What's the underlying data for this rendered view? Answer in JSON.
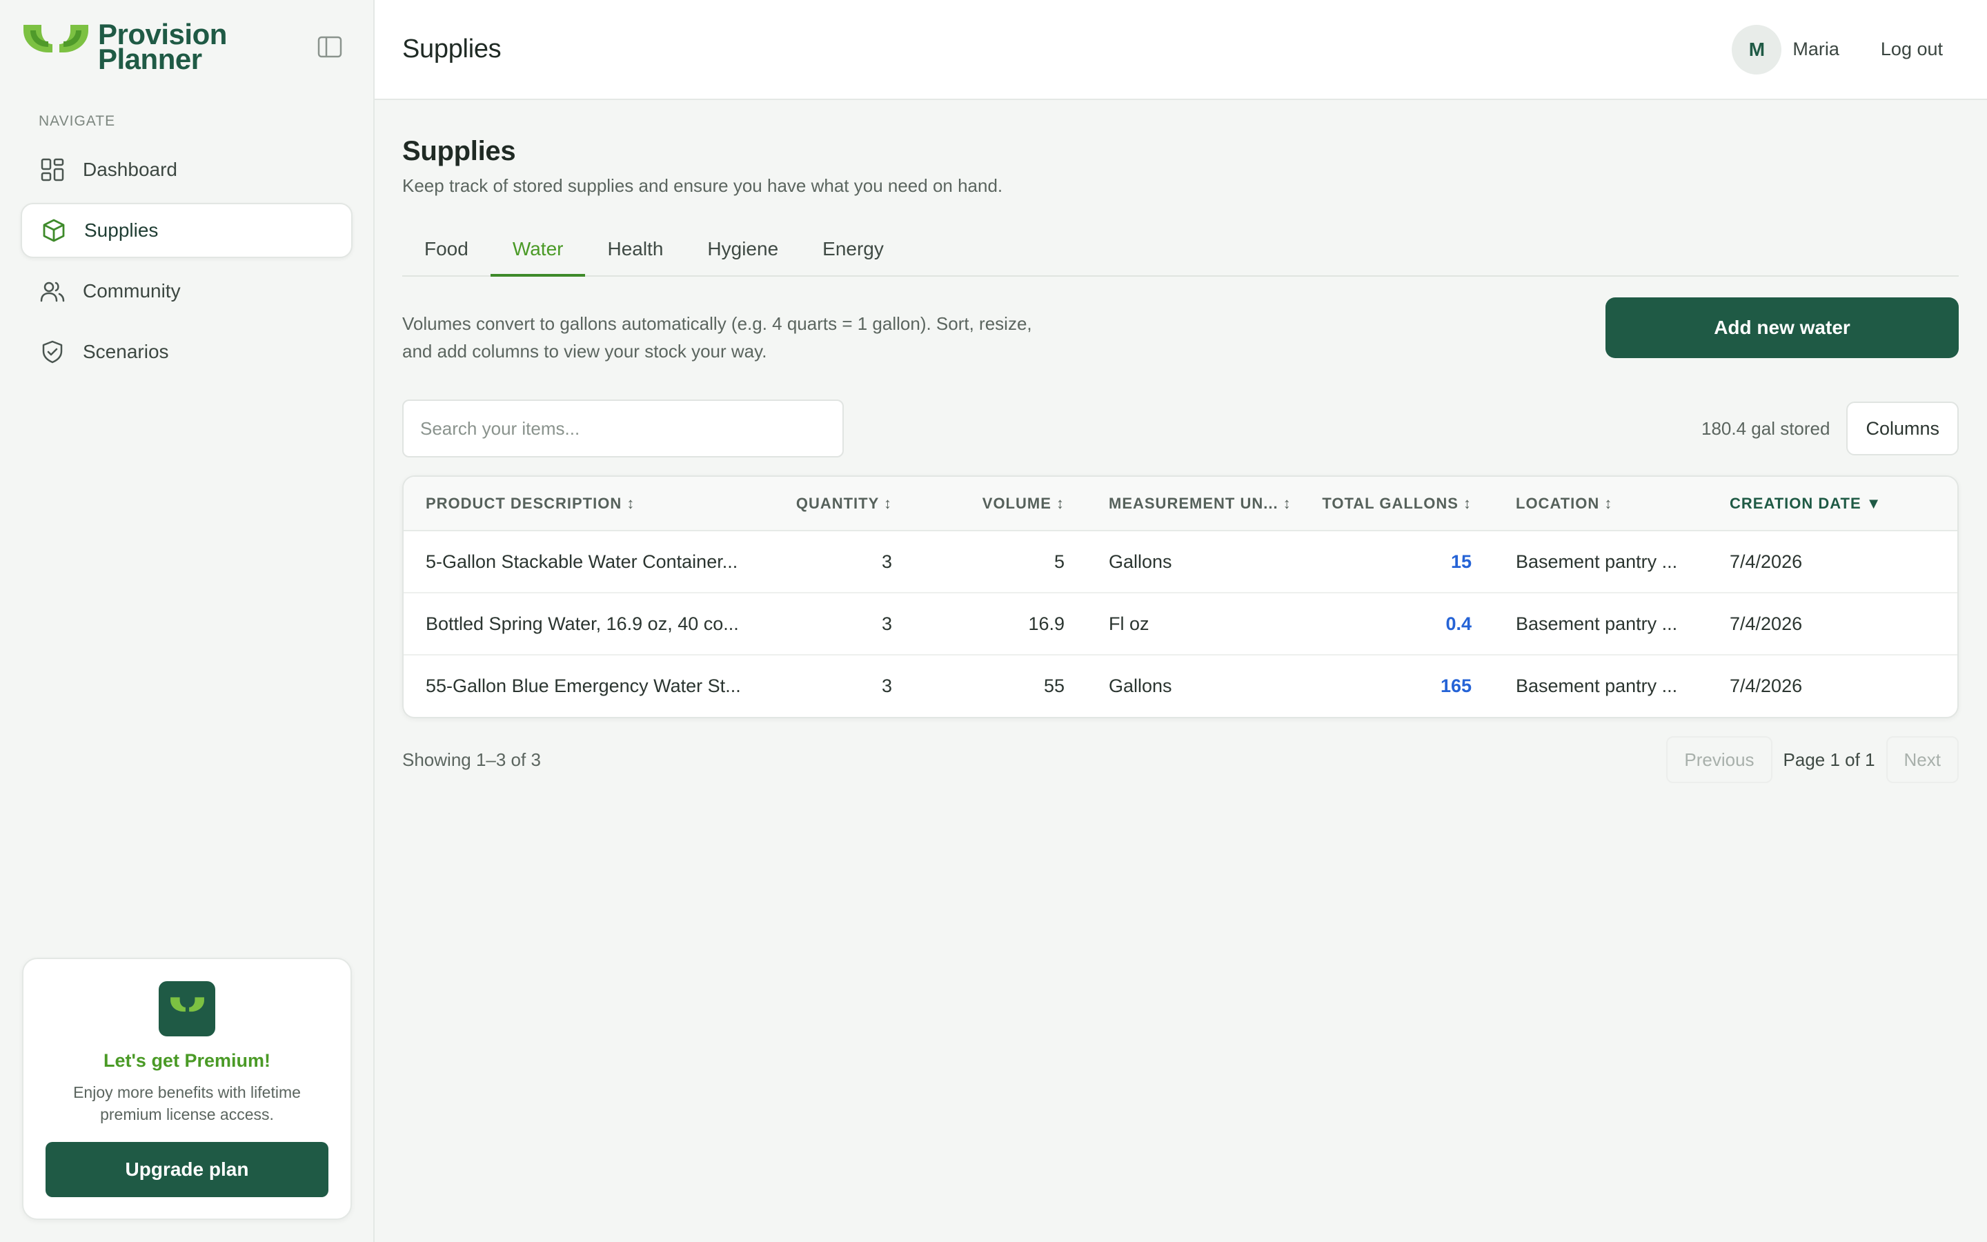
{
  "brand": {
    "line1": "Provision",
    "line2": "Planner"
  },
  "sidebar": {
    "section_label": "NAVIGATE",
    "items": [
      {
        "label": "Dashboard",
        "icon": "dashboard-grid-icon"
      },
      {
        "label": "Supplies",
        "icon": "package-box-icon",
        "active": true
      },
      {
        "label": "Community",
        "icon": "users-icon"
      },
      {
        "label": "Scenarios",
        "icon": "shield-check-icon"
      }
    ]
  },
  "premium": {
    "title": "Let's get Premium!",
    "text": "Enjoy more benefits with lifetime premium license access.",
    "button": "Upgrade plan"
  },
  "topbar": {
    "title": "Supplies",
    "avatar_initial": "M",
    "user_name": "Maria",
    "logout": "Log out"
  },
  "page": {
    "heading": "Supplies",
    "subheading": "Keep track of stored supplies and ensure you have what you need on hand."
  },
  "tabs": [
    {
      "label": "Food"
    },
    {
      "label": "Water",
      "active": true
    },
    {
      "label": "Health"
    },
    {
      "label": "Hygiene"
    },
    {
      "label": "Energy"
    }
  ],
  "info_text": "Volumes convert to gallons automatically (e.g. 4 quarts = 1 gallon). Sort, resize, and add columns to view your stock your way.",
  "add_button": "Add new water",
  "search": {
    "placeholder": "Search your items...",
    "value": ""
  },
  "stored_total": "180.4 gal stored",
  "columns_button": "Columns",
  "table": {
    "headers": [
      "PRODUCT DESCRIPTION ↕",
      "QUANTITY ↕",
      "VOLUME ↕",
      "MEASUREMENT UN... ↕",
      "TOTAL GALLONS ↕",
      "LOCATION ↕",
      "CREATION DATE ▼"
    ],
    "rows": [
      [
        "5-Gallon Stackable Water Container...",
        "3",
        "5",
        "Gallons",
        "15",
        "Basement pantry ...",
        "7/4/2026"
      ],
      [
        "Bottled Spring Water, 16.9 oz, 40 co...",
        "3",
        "16.9",
        "Fl oz",
        "0.4",
        "Basement pantry ...",
        "7/4/2026"
      ],
      [
        "55-Gallon Blue Emergency Water St...",
        "3",
        "55",
        "Gallons",
        "165",
        "Basement pantry ...",
        "7/4/2026"
      ]
    ]
  },
  "footer": {
    "showing": "Showing 1–3 of 3",
    "previous": "Previous",
    "page_info": "Page 1 of 1",
    "next": "Next"
  },
  "colors": {
    "brand_dark": "#1f5a45",
    "brand_green": "#7cc142",
    "active_tab": "#4a9a26",
    "gallons_link": "#2563d6"
  }
}
